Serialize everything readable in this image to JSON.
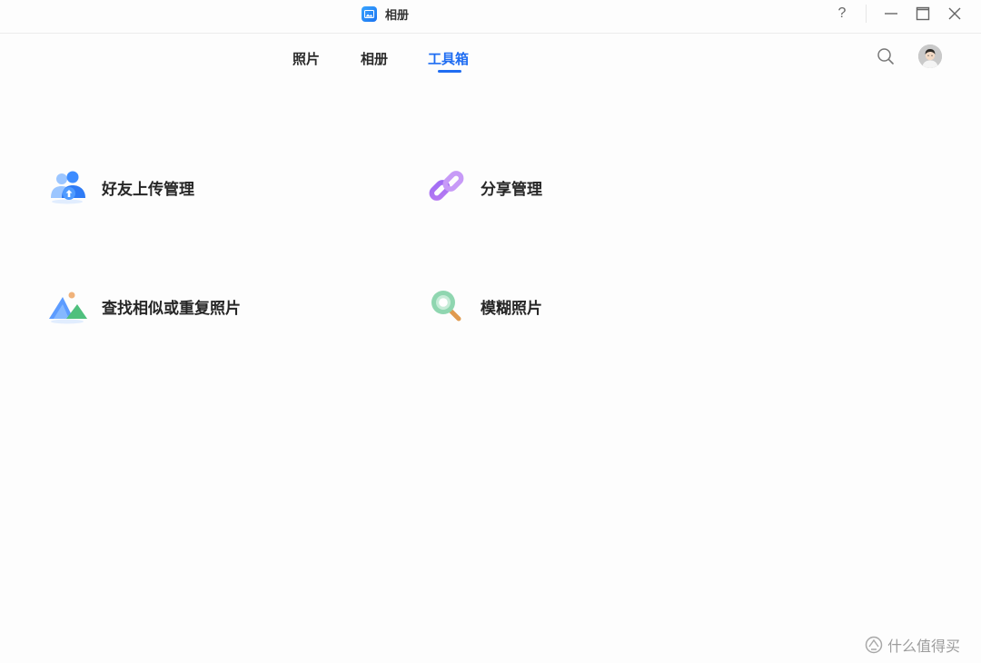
{
  "window": {
    "title": "相册",
    "controls": {
      "help": "?"
    }
  },
  "nav": {
    "tabs": [
      {
        "label": "照片",
        "active": false
      },
      {
        "label": "相册",
        "active": false
      },
      {
        "label": "工具箱",
        "active": true
      }
    ],
    "accent_color": "#1f6df2"
  },
  "icons": {
    "app": "photo-album-icon",
    "search": "search-icon",
    "avatar": "user-avatar",
    "friend_upload": "friend-upload-icon",
    "share": "link-icon",
    "similar": "mountain-photo-icon",
    "blur": "magnifier-icon"
  },
  "tools": [
    {
      "label": "好友上传管理"
    },
    {
      "label": "分享管理"
    },
    {
      "label": "查找相似或重复照片"
    },
    {
      "label": "模糊照片"
    }
  ],
  "watermark": {
    "text": "什么值得买"
  }
}
